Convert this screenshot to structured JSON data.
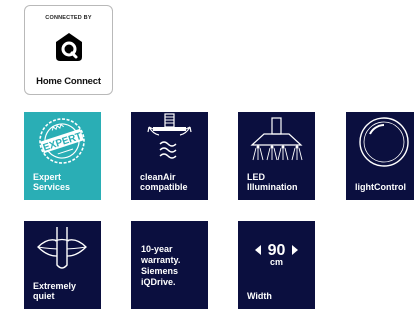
{
  "badge": {
    "top_text": "CONNECTED BY",
    "brand": "Home Connect",
    "icon": "home-connect-house-icon"
  },
  "tiles": [
    {
      "label": "Expert\nServices",
      "stamp": "EXPERT",
      "icon": "expert-stamp-icon",
      "color": "#2aaeb5"
    },
    {
      "label": "cleanAir\ncompatible",
      "icon": "clean-air-icon",
      "color": "#0b0f3f"
    },
    {
      "label": "LED\nIllumination",
      "icon": "led-hood-icon",
      "color": "#0b0f3f"
    },
    {
      "label": "lightControl",
      "icon": "light-control-icon",
      "color": "#0b0f3f"
    },
    {
      "label": "Extremely\nquiet",
      "icon": "quiet-lips-icon",
      "color": "#0b0f3f"
    },
    {
      "text": "10-year\nwarranty.\nSiemens\niQDrive.",
      "color": "#0b0f3f"
    },
    {
      "label": "Width",
      "value": "90",
      "unit": "cm",
      "icon": "width-arrows-icon",
      "color": "#0b0f3f"
    }
  ]
}
